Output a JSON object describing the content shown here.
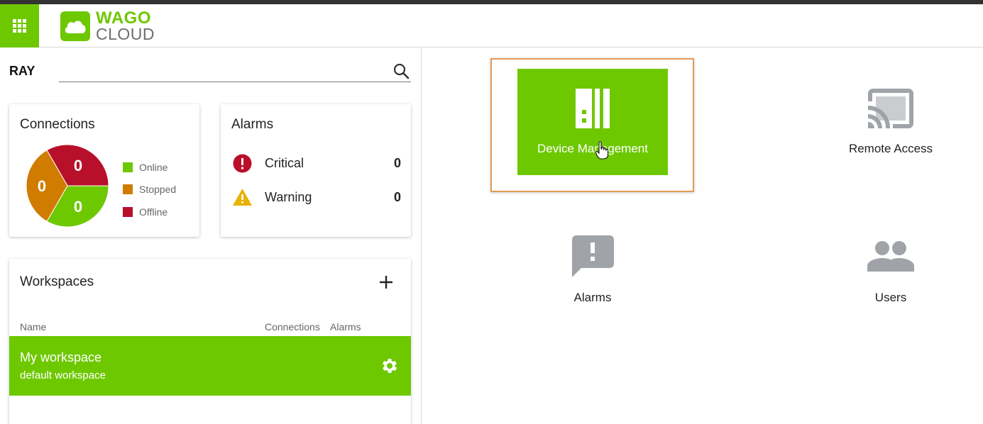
{
  "app": {
    "brand_top": "WAGO",
    "brand_bottom": "CLOUD"
  },
  "header": {
    "apps_icon": "grid-apps-icon"
  },
  "user": {
    "name": "RAY"
  },
  "search": {
    "placeholder": "",
    "value": "",
    "icon": "search-icon"
  },
  "connections": {
    "title": "Connections",
    "online_count": "0",
    "stopped_count": "0",
    "offline_count": "0",
    "legend": [
      {
        "label": "Online",
        "color": "#6ec800"
      },
      {
        "label": "Stopped",
        "color": "#d07c00"
      },
      {
        "label": "Offline",
        "color": "#b8102a"
      }
    ]
  },
  "alarms_card": {
    "title": "Alarms",
    "rows": [
      {
        "label": "Critical",
        "count": "0",
        "icon": "critical-alert-icon",
        "color": "#b8102a"
      },
      {
        "label": "Warning",
        "count": "0",
        "icon": "warning-triangle-icon",
        "color": "#e8b200"
      }
    ]
  },
  "workspaces": {
    "title": "Workspaces",
    "add_icon": "plus-icon",
    "columns": [
      "Name",
      "Connections",
      "Alarms"
    ],
    "items": [
      {
        "name": "My workspace",
        "description": "default workspace",
        "icon": "gear-icon"
      }
    ]
  },
  "tiles": [
    {
      "label": "Device Management",
      "icon": "device-icon",
      "active": true
    },
    {
      "label": "Remote Access",
      "icon": "cast-icon",
      "active": false
    },
    {
      "label": "Alarms",
      "icon": "alarm-message-icon",
      "active": false
    },
    {
      "label": "Users",
      "icon": "users-icon",
      "active": false
    }
  ],
  "colors": {
    "accent": "#6ec800",
    "focus_border": "#e39a55",
    "icon_gray": "#a0a3a8"
  }
}
